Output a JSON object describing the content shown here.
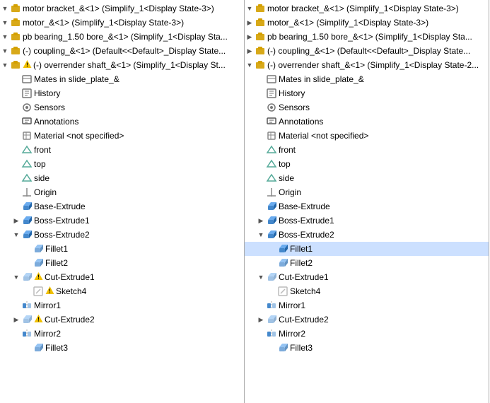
{
  "panels": [
    {
      "id": "left",
      "items": [
        {
          "id": "motor_bracket",
          "level": 0,
          "expand": true,
          "icon": "part",
          "label": "motor bracket_&<1> (Simplify_1<Display State-3>)",
          "warn": false,
          "selected": false
        },
        {
          "id": "motor",
          "level": 0,
          "expand": false,
          "icon": "part",
          "label": "motor_&<1> (Simplify_1<Display State-3>)",
          "warn": false,
          "selected": false
        },
        {
          "id": "pb_bearing",
          "level": 0,
          "expand": false,
          "icon": "part",
          "label": "pb bearing_1.50 bore_&<1> (Simplify_1<Display Sta...",
          "warn": false,
          "selected": false
        },
        {
          "id": "coupling",
          "level": 0,
          "expand": false,
          "icon": "part",
          "label": "(-) coupling_&<1> (Default<<Default>_Display State...",
          "warn": false,
          "selected": false
        },
        {
          "id": "overrender_shaft",
          "level": 0,
          "expand": true,
          "icon": "part-warn",
          "label": "(-) overrender shaft_&<1> (Simplify_1<Display St...",
          "warn": true,
          "selected": false
        },
        {
          "id": "mates",
          "level": 1,
          "expand": false,
          "icon": "mates",
          "label": "Mates in slide_plate_&",
          "warn": false,
          "selected": false
        },
        {
          "id": "history_l",
          "level": 1,
          "expand": false,
          "icon": "history",
          "label": "History",
          "warn": false,
          "selected": false
        },
        {
          "id": "sensors",
          "level": 1,
          "expand": false,
          "icon": "sensor",
          "label": "Sensors",
          "warn": false,
          "selected": false
        },
        {
          "id": "annotations",
          "level": 1,
          "expand": false,
          "icon": "annotation",
          "label": "Annotations",
          "warn": false,
          "selected": false
        },
        {
          "id": "material",
          "level": 1,
          "expand": false,
          "icon": "material",
          "label": "Material <not specified>",
          "warn": false,
          "selected": false
        },
        {
          "id": "front",
          "level": 1,
          "expand": false,
          "icon": "plane",
          "label": "front",
          "warn": false,
          "selected": false
        },
        {
          "id": "top",
          "level": 1,
          "expand": false,
          "icon": "plane",
          "label": "top",
          "warn": false,
          "selected": false
        },
        {
          "id": "side",
          "level": 1,
          "expand": false,
          "icon": "plane",
          "label": "side",
          "warn": false,
          "selected": false
        },
        {
          "id": "origin",
          "level": 1,
          "expand": false,
          "icon": "origin",
          "label": "Origin",
          "warn": false,
          "selected": false
        },
        {
          "id": "base_extrude",
          "level": 1,
          "expand": false,
          "icon": "extrude",
          "label": "Base-Extrude",
          "warn": false,
          "selected": false
        },
        {
          "id": "boss_extrude1",
          "level": 1,
          "expand": false,
          "icon": "extrude",
          "label": "Boss-Extrude1",
          "warn": false,
          "selected": false
        },
        {
          "id": "boss_extrude2",
          "level": 1,
          "expand": true,
          "icon": "extrude",
          "label": "Boss-Extrude2",
          "warn": false,
          "selected": false
        },
        {
          "id": "fillet1",
          "level": 2,
          "expand": false,
          "icon": "fillet",
          "label": "Fillet1",
          "warn": false,
          "selected": false
        },
        {
          "id": "fillet2",
          "level": 2,
          "expand": false,
          "icon": "fillet",
          "label": "Fillet2",
          "warn": false,
          "selected": false
        },
        {
          "id": "cut_extrude1",
          "level": 1,
          "expand": true,
          "icon": "cut-warn",
          "label": "Cut-Extrude1",
          "warn": true,
          "selected": false
        },
        {
          "id": "sketch4",
          "level": 2,
          "expand": false,
          "icon": "sketch-warn",
          "label": "Sketch4",
          "warn": true,
          "selected": false
        },
        {
          "id": "mirror1",
          "level": 1,
          "expand": false,
          "icon": "mirror",
          "label": "Mirror1",
          "warn": false,
          "selected": false
        },
        {
          "id": "cut_extrude2",
          "level": 1,
          "expand": false,
          "icon": "cut-warn",
          "label": "Cut-Extrude2",
          "warn": true,
          "selected": false
        },
        {
          "id": "mirror2",
          "level": 1,
          "expand": false,
          "icon": "mirror",
          "label": "Mirror2",
          "warn": false,
          "selected": false
        },
        {
          "id": "fillet3",
          "level": 2,
          "expand": false,
          "icon": "fillet",
          "label": "Fillet3",
          "warn": false,
          "selected": false
        }
      ]
    },
    {
      "id": "right",
      "items": [
        {
          "id": "motor_bracket_r",
          "level": 0,
          "expand": true,
          "icon": "part",
          "label": "motor bracket_&<1> (Simplify_1<Display State-3>)",
          "warn": false,
          "selected": false
        },
        {
          "id": "motor_r",
          "level": 0,
          "expand": false,
          "icon": "part",
          "label": "motor_&<1> (Simplify_1<Display State-3>)",
          "warn": false,
          "selected": false
        },
        {
          "id": "pb_bearing_r",
          "level": 0,
          "expand": false,
          "icon": "part",
          "label": "pb bearing_1.50 bore_&<1> (Simplify_1<Display Sta...",
          "warn": false,
          "selected": false
        },
        {
          "id": "coupling_r",
          "level": 0,
          "expand": false,
          "icon": "part",
          "label": "(-) coupling_&<1> (Default<<Default>_Display State...",
          "warn": false,
          "selected": false
        },
        {
          "id": "overrender_shaft_r",
          "level": 0,
          "expand": true,
          "icon": "part",
          "label": "(-) overrender shaft_&<1> (Simplify_1<Display State-2...",
          "warn": false,
          "selected": false
        },
        {
          "id": "mates_r",
          "level": 1,
          "expand": false,
          "icon": "mates",
          "label": "Mates in slide_plate_&",
          "warn": false,
          "selected": false
        },
        {
          "id": "history_r",
          "level": 1,
          "expand": false,
          "icon": "history",
          "label": "History",
          "warn": false,
          "selected": false
        },
        {
          "id": "sensors_r",
          "level": 1,
          "expand": false,
          "icon": "sensor",
          "label": "Sensors",
          "warn": false,
          "selected": false
        },
        {
          "id": "annotations_r",
          "level": 1,
          "expand": false,
          "icon": "annotation",
          "label": "Annotations",
          "warn": false,
          "selected": false
        },
        {
          "id": "material_r",
          "level": 1,
          "expand": false,
          "icon": "material",
          "label": "Material <not specified>",
          "warn": false,
          "selected": false
        },
        {
          "id": "front_r",
          "level": 1,
          "expand": false,
          "icon": "plane",
          "label": "front",
          "warn": false,
          "selected": false
        },
        {
          "id": "top_r",
          "level": 1,
          "expand": false,
          "icon": "plane",
          "label": "top",
          "warn": false,
          "selected": false
        },
        {
          "id": "side_r",
          "level": 1,
          "expand": false,
          "icon": "plane",
          "label": "side",
          "warn": false,
          "selected": false
        },
        {
          "id": "origin_r",
          "level": 1,
          "expand": false,
          "icon": "origin",
          "label": "Origin",
          "warn": false,
          "selected": false
        },
        {
          "id": "base_extrude_r",
          "level": 1,
          "expand": false,
          "icon": "extrude",
          "label": "Base-Extrude",
          "warn": false,
          "selected": false
        },
        {
          "id": "boss_extrude1_r",
          "level": 1,
          "expand": false,
          "icon": "extrude",
          "label": "Boss-Extrude1",
          "warn": false,
          "selected": false
        },
        {
          "id": "boss_extrude2_r",
          "level": 1,
          "expand": true,
          "icon": "extrude",
          "label": "Boss-Extrude2",
          "warn": false,
          "selected": false
        },
        {
          "id": "fillet1_r",
          "level": 2,
          "expand": false,
          "icon": "fillet",
          "label": "Fillet1",
          "warn": false,
          "selected": true
        },
        {
          "id": "fillet2_r",
          "level": 2,
          "expand": false,
          "icon": "fillet",
          "label": "Fillet2",
          "warn": false,
          "selected": false
        },
        {
          "id": "cut_extrude1_r",
          "level": 1,
          "expand": true,
          "icon": "cut",
          "label": "Cut-Extrude1",
          "warn": false,
          "selected": false
        },
        {
          "id": "sketch4_r",
          "level": 2,
          "expand": false,
          "icon": "sketch",
          "label": "Sketch4",
          "warn": false,
          "selected": false
        },
        {
          "id": "mirror1_r",
          "level": 1,
          "expand": false,
          "icon": "mirror",
          "label": "Mirror1",
          "warn": false,
          "selected": false
        },
        {
          "id": "cut_extrude2_r",
          "level": 1,
          "expand": false,
          "icon": "cut",
          "label": "Cut-Extrude2",
          "warn": false,
          "selected": false
        },
        {
          "id": "mirror2_r",
          "level": 1,
          "expand": false,
          "icon": "mirror",
          "label": "Mirror2",
          "warn": false,
          "selected": false
        },
        {
          "id": "fillet3_r",
          "level": 2,
          "expand": false,
          "icon": "fillet",
          "label": "Fillet3",
          "warn": false,
          "selected": false
        }
      ]
    }
  ],
  "icons": {
    "part": "🟡",
    "expand_open": "▼",
    "expand_closed": "▶"
  }
}
